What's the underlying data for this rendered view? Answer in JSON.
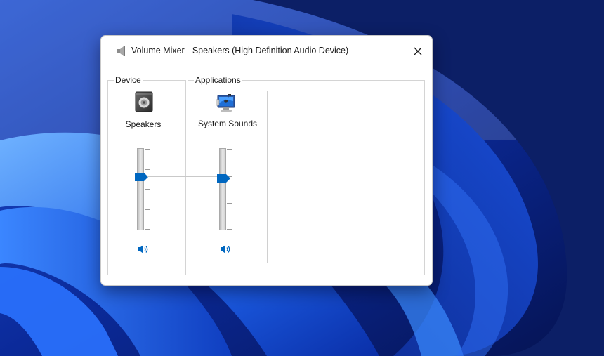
{
  "window": {
    "title": "Volume Mixer - Speakers (High Definition Audio Device)"
  },
  "device_group": {
    "legend_prefix": "D",
    "legend_rest": "evice",
    "channel": {
      "label": "Speakers",
      "volume_fraction": 0.65,
      "icon": "speaker-device-icon",
      "mute_icon": "speaker-volume-icon"
    }
  },
  "applications_group": {
    "legend": "Applications",
    "channels": [
      {
        "label": "System Sounds",
        "volume_fraction": 0.63,
        "icon": "system-sounds-icon",
        "mute_icon": "speaker-volume-icon"
      }
    ]
  },
  "colors": {
    "accent": "#0067c0",
    "wallpaper_dark": "#0a2a8c",
    "wallpaper_light": "#3f8cff"
  }
}
